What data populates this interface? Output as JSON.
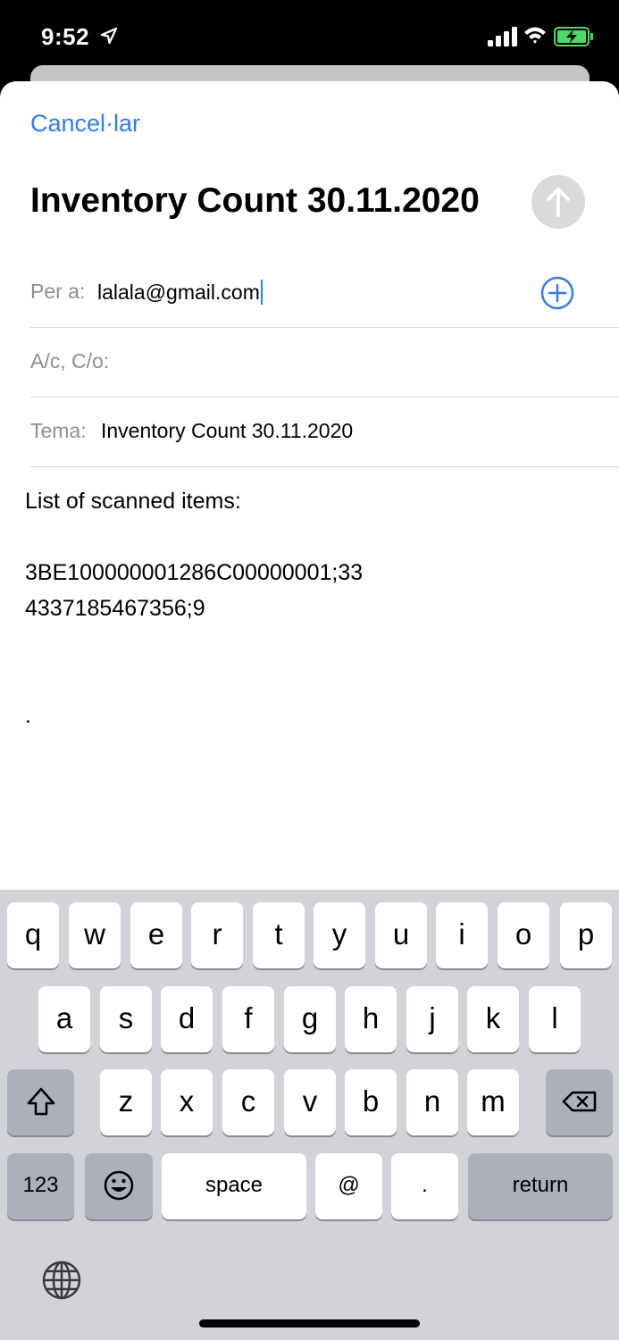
{
  "status_bar": {
    "time": "9:52"
  },
  "compose": {
    "cancel_label": "Cancel·lar",
    "title": "Inventory Count 30.11.2020",
    "to_label": "Per a:",
    "to_value": "lalala@gmail.com",
    "cc_label": "A/c, C/o:",
    "subject_label": "Tema:",
    "subject_value": "Inventory Count 30.11.2020",
    "body_lines": [
      "List of scanned items:",
      "",
      "3BE100000001286C00000001;33",
      "4337185467356;9",
      "",
      "",
      "."
    ]
  },
  "keyboard": {
    "row1": [
      "q",
      "w",
      "e",
      "r",
      "t",
      "y",
      "u",
      "i",
      "o",
      "p"
    ],
    "row2": [
      "a",
      "s",
      "d",
      "f",
      "g",
      "h",
      "j",
      "k",
      "l"
    ],
    "row3": [
      "z",
      "x",
      "c",
      "v",
      "b",
      "n",
      "m"
    ],
    "numbers_label": "123",
    "space_label": "space",
    "at_label": "@",
    "dot_label": ".",
    "return_label": "return"
  },
  "colors": {
    "accent": "#2f7cf6",
    "keyboard_bg": "#d2d3d8",
    "key_dark": "#abb0bb"
  },
  "icons": [
    "location-arrow-icon",
    "signal-icon",
    "wifi-icon",
    "battery-icon",
    "arrow-up-icon",
    "plus-circle-icon",
    "shift-icon",
    "delete-icon",
    "emoji-icon",
    "globe-icon"
  ]
}
